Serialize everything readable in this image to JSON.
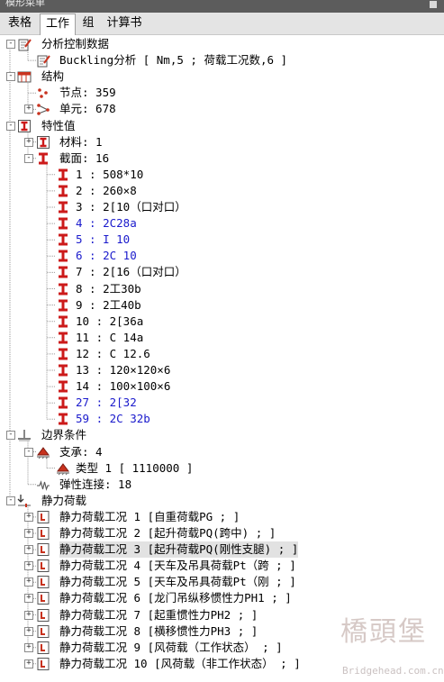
{
  "window": {
    "title": "模形菜单"
  },
  "tabs": [
    "表格",
    "工作",
    "组",
    "计算书"
  ],
  "active_tab": 1,
  "tree": [
    {
      "level": 0,
      "expander": "-",
      "icon": "analysis-control-icon",
      "label": "分析控制数据"
    },
    {
      "level": 1,
      "expander": "",
      "icon": "analysis-control-icon",
      "label": "Buckling分析 [ Nm,5 ; 荷载工况数,6 ]"
    },
    {
      "level": 0,
      "expander": "-",
      "icon": "structure-icon",
      "label": "结构"
    },
    {
      "level": 1,
      "expander": "",
      "icon": "node-icon",
      "label": "节点: 359"
    },
    {
      "level": 1,
      "expander": "+",
      "icon": "element-icon",
      "label": "单元: 678"
    },
    {
      "level": 0,
      "expander": "-",
      "icon": "property-icon",
      "label": "特性值"
    },
    {
      "level": 1,
      "expander": "+",
      "icon": "material-icon",
      "label": "材料: 1"
    },
    {
      "level": 1,
      "expander": "-",
      "icon": "section-icon",
      "label": "截面: 16"
    },
    {
      "level": 2,
      "expander": "",
      "icon": "section-icon",
      "label": "1 : 508*10"
    },
    {
      "level": 2,
      "expander": "",
      "icon": "section-icon",
      "label": "2 : 260×8"
    },
    {
      "level": 2,
      "expander": "",
      "icon": "section-icon",
      "label": "3 : 2[10（口对口）"
    },
    {
      "level": 2,
      "expander": "",
      "icon": "section-icon",
      "label": "4 : 2C28a",
      "color": "blue"
    },
    {
      "level": 2,
      "expander": "",
      "icon": "section-icon",
      "label": "5 : I 10",
      "color": "blue"
    },
    {
      "level": 2,
      "expander": "",
      "icon": "section-icon",
      "label": "6 : 2C 10",
      "color": "blue"
    },
    {
      "level": 2,
      "expander": "",
      "icon": "section-icon",
      "label": "7 : 2[16（口对口）"
    },
    {
      "level": 2,
      "expander": "",
      "icon": "section-icon",
      "label": "8 : 2工30b"
    },
    {
      "level": 2,
      "expander": "",
      "icon": "section-icon",
      "label": "9 : 2工40b"
    },
    {
      "level": 2,
      "expander": "",
      "icon": "section-icon",
      "label": "10 : 2[36a"
    },
    {
      "level": 2,
      "expander": "",
      "icon": "section-icon",
      "label": "11 : C 14a"
    },
    {
      "level": 2,
      "expander": "",
      "icon": "section-icon",
      "label": "12 : C 12.6"
    },
    {
      "level": 2,
      "expander": "",
      "icon": "section-icon",
      "label": "13 : 120×120×6"
    },
    {
      "level": 2,
      "expander": "",
      "icon": "section-icon",
      "label": "14 : 100×100×6"
    },
    {
      "level": 2,
      "expander": "",
      "icon": "section-icon",
      "label": "27 : 2[32",
      "color": "blue"
    },
    {
      "level": 2,
      "expander": "",
      "icon": "section-icon",
      "label": "59 : 2C 32b",
      "color": "blue"
    },
    {
      "level": 0,
      "expander": "-",
      "icon": "boundary-icon",
      "label": "边界条件"
    },
    {
      "level": 1,
      "expander": "-",
      "icon": "support-icon",
      "label": "支承: 4"
    },
    {
      "level": 2,
      "expander": "",
      "icon": "support-icon",
      "label": "类型 1 [ 1110000 ]"
    },
    {
      "level": 1,
      "expander": "",
      "icon": "spring-icon",
      "label": "弹性连接: 18"
    },
    {
      "level": 0,
      "expander": "-",
      "icon": "static-load-icon",
      "label": "静力荷载"
    },
    {
      "level": 1,
      "expander": "+",
      "icon": "load-case-icon",
      "label": "静力荷载工况 1 [自重荷载PG ; ]"
    },
    {
      "level": 1,
      "expander": "+",
      "icon": "load-case-icon",
      "label": "静力荷载工况 2 [起升荷载PQ(跨中) ; ]"
    },
    {
      "level": 1,
      "expander": "+",
      "icon": "load-case-icon",
      "label": "静力荷载工况 3 [起升荷载PQ(刚性支腿) ; ]",
      "selected": true
    },
    {
      "level": 1,
      "expander": "+",
      "icon": "load-case-icon",
      "label": "静力荷载工况 4 [天车及吊具荷载Pt（跨 ; ]"
    },
    {
      "level": 1,
      "expander": "+",
      "icon": "load-case-icon",
      "label": "静力荷载工况 5 [天车及吊具荷载Pt（刚 ; ]"
    },
    {
      "level": 1,
      "expander": "+",
      "icon": "load-case-icon",
      "label": "静力荷载工况 6 [龙门吊纵移惯性力PH1 ; ]"
    },
    {
      "level": 1,
      "expander": "+",
      "icon": "load-case-icon",
      "label": "静力荷载工况 7 [起重惯性力PH2 ; ]"
    },
    {
      "level": 1,
      "expander": "+",
      "icon": "load-case-icon",
      "label": "静力荷载工况 8 [横移惯性力PH3 ; ]"
    },
    {
      "level": 1,
      "expander": "+",
      "icon": "load-case-icon",
      "label": "静力荷载工况 9 [风荷载（工作状态） ; ]"
    },
    {
      "level": 1,
      "expander": "+",
      "icon": "load-case-icon",
      "label": "静力荷载工况 10 [风荷载（非工作状态） ; ]"
    }
  ],
  "watermark": {
    "text": "橋頭堡",
    "url": "Bridgehead.com.cn"
  },
  "colors": {
    "blue_label": "#1a1acc",
    "section_icon": "#cc1a1a",
    "selection": "#e2e2e2"
  }
}
